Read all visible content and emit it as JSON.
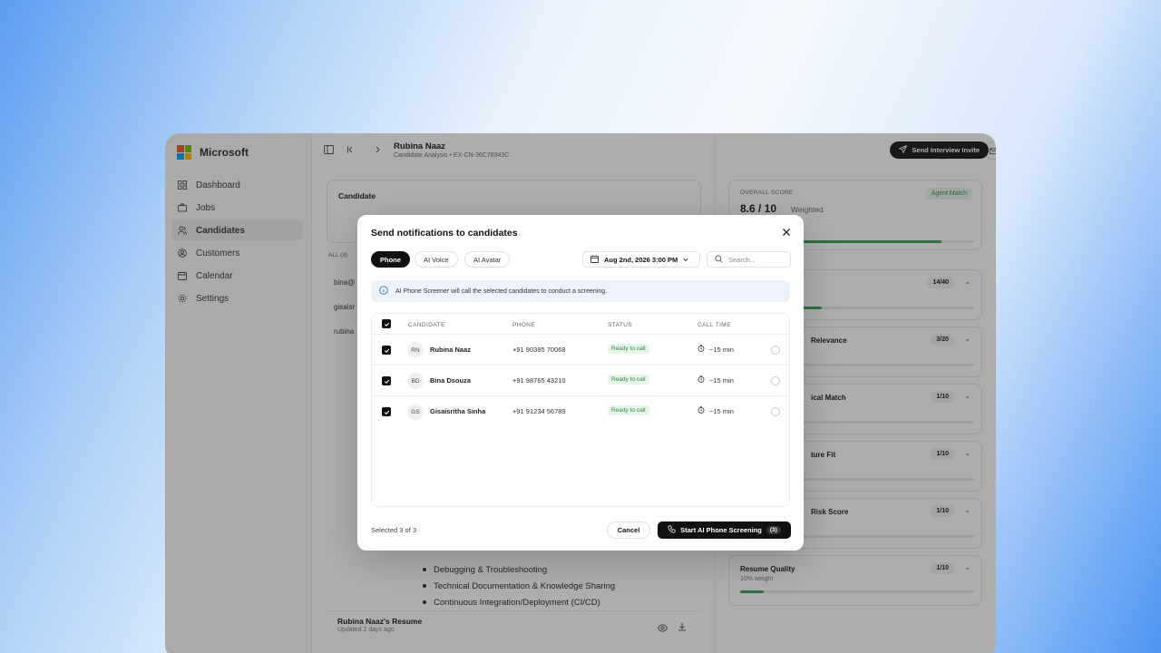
{
  "sidebar": {
    "brand": "Microsoft",
    "items": [
      {
        "label": "Dashboard",
        "icon": "grid-icon"
      },
      {
        "label": "Jobs",
        "icon": "briefcase-icon"
      },
      {
        "label": "Candidates",
        "icon": "users-icon",
        "active": true
      },
      {
        "label": "Customers",
        "icon": "customers-icon"
      },
      {
        "label": "Calendar",
        "icon": "calendar-icon"
      },
      {
        "label": "Settings",
        "icon": "gear-icon"
      }
    ]
  },
  "header": {
    "title": "Rubina Naaz",
    "subtitle": "Candidate Analysis  •  EX-CN-36C78343C",
    "invite_label": "Send Interview Invite"
  },
  "main": {
    "candidate_label": "Candidate",
    "all_label": "ALL (3)",
    "emails": [
      "bina@",
      "gisaisr",
      "rubina"
    ],
    "skills": [
      "Debugging & Troubleshooting",
      "Technical Documentation & Knowledge Sharing",
      "Continuous Integration/Deployment (CI/CD)"
    ],
    "resume_title": "Rubina Naaz's Resume",
    "resume_updated": "Updated 2 days ago"
  },
  "score": {
    "label": "OVERALL SCORE",
    "badge": "Agent Match",
    "value": "8.6 / 10",
    "weighted": "Weighted",
    "fraction": 0.86
  },
  "metrics": [
    {
      "name": "",
      "score": "14/40",
      "fraction": 0.35
    },
    {
      "name": "Relevance",
      "score": "3/20",
      "fraction": 0.15
    },
    {
      "name": "ical Match",
      "score": "1/10",
      "fraction": 0.1
    },
    {
      "name": "ture Fit",
      "score": "1/10",
      "fraction": 0.1
    },
    {
      "name": "Risk Score",
      "score": "1/10",
      "fraction": 0.1
    },
    {
      "name": "Resume Quality",
      "sub": "10% weight",
      "score": "1/10",
      "fraction": 0.1
    }
  ],
  "modal": {
    "title": "Send notifications to candidates",
    "tabs": [
      "Phone",
      "AI Voice",
      "AI Avatar"
    ],
    "date": "Aug 2nd, 2026 3:00 PM",
    "search_placeholder": "Search...",
    "info": "AI Phone Screener will call the selected candidates to conduct a screening.",
    "columns": [
      "CANDIDATE",
      "PHONE",
      "STATUS",
      "CALL TIME"
    ],
    "rows": [
      {
        "initials": "RN",
        "name": "Rubina Naaz",
        "phone": "+91 90385 70068",
        "status": "Ready to call",
        "time": "~15 min"
      },
      {
        "initials": "BD",
        "name": "Bina Dsouza",
        "phone": "+91 98765 43210",
        "status": "Ready to call",
        "time": "~15 min"
      },
      {
        "initials": "GS",
        "name": "Gisaisritha Sinha",
        "phone": "+91 91234 56789",
        "status": "Ready to call",
        "time": "~15 min"
      }
    ],
    "selected": "Selected 3 of 3",
    "cancel": "Cancel",
    "start": "Start AI Phone Screening",
    "start_count": "(3)"
  },
  "colors": {
    "accent_green": "#2f9e4a",
    "primary": "#111111",
    "info_bg": "#eef3fb"
  }
}
